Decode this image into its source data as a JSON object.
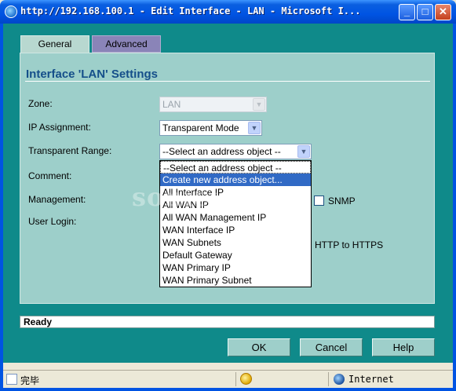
{
  "window": {
    "title": "http://192.168.100.1 - Edit Interface - LAN - Microsoft I...",
    "min_glyph": "_",
    "max_glyph": "□",
    "close_glyph": "✕"
  },
  "tabs": [
    {
      "label": "General",
      "active": true
    },
    {
      "label": "Advanced",
      "active": false
    }
  ],
  "panel": {
    "title": "Interface 'LAN' Settings"
  },
  "fields": {
    "zone": {
      "label": "Zone:",
      "value": "LAN",
      "disabled": true
    },
    "ip_assignment": {
      "label": "IP Assignment:",
      "value": "Transparent Mode"
    },
    "transparent_range": {
      "label": "Transparent Range:",
      "value": "--Select an address object --"
    },
    "comment": {
      "label": "Comment:"
    },
    "management": {
      "label": "Management:",
      "snmp_label": "SNMP",
      "snmp_checked": false
    },
    "user_login": {
      "label": "User Login:",
      "redirect_label": "HTTP to HTTPS"
    }
  },
  "dropdown": {
    "options": [
      "--Select an address object --",
      "Create new address object...",
      "All Interface IP",
      "All WAN IP",
      "All WAN Management IP",
      "WAN Interface IP",
      "WAN Subnets",
      "Default Gateway",
      "WAN Primary IP",
      "WAN Primary Subnet"
    ],
    "highlighted_index": 1
  },
  "watermark": "sonicwall.hi",
  "status": {
    "text": "Ready"
  },
  "buttons": {
    "ok": "OK",
    "cancel": "Cancel",
    "help": "Help"
  },
  "ie_status": {
    "done": "完毕",
    "zone": "Internet"
  },
  "icons": {
    "app": "ie-icon",
    "dropdown_arrow": "chevron-down-icon",
    "security": "lock-icon",
    "zone": "globe-icon"
  },
  "colors": {
    "titlebar": "#0054e3",
    "background": "#0f8a8a",
    "panel": "#9dcfca",
    "selection": "#316ac5",
    "heading": "#154f8a"
  }
}
